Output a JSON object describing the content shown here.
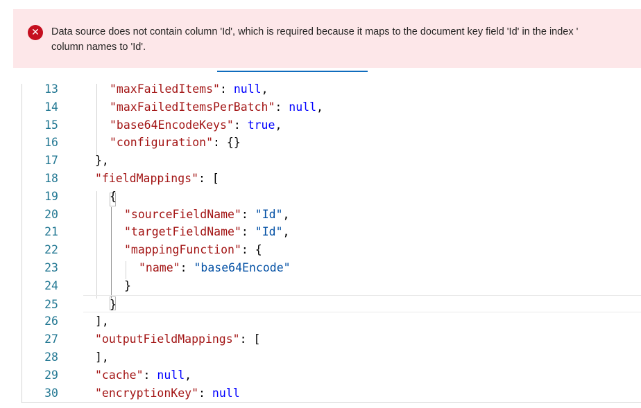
{
  "error": {
    "icon": "error-circle-icon",
    "message_line1": "Data source does not contain column 'Id', which is required because it maps to the document key field 'Id' in the index '",
    "message_line2": "column names to 'Id'."
  },
  "editor": {
    "lines": [
      {
        "num": "13",
        "tokens": [
          {
            "t": "k",
            "v": "\"maxFailedItems\""
          },
          {
            "t": "p",
            "v": ": "
          },
          {
            "t": "b",
            "v": "null"
          },
          {
            "t": "p",
            "v": ","
          }
        ],
        "indent": 2
      },
      {
        "num": "14",
        "tokens": [
          {
            "t": "k",
            "v": "\"maxFailedItemsPerBatch\""
          },
          {
            "t": "p",
            "v": ": "
          },
          {
            "t": "b",
            "v": "null"
          },
          {
            "t": "p",
            "v": ","
          }
        ],
        "indent": 2
      },
      {
        "num": "15",
        "tokens": [
          {
            "t": "k",
            "v": "\"base64EncodeKeys\""
          },
          {
            "t": "p",
            "v": ": "
          },
          {
            "t": "b",
            "v": "true"
          },
          {
            "t": "p",
            "v": ","
          }
        ],
        "indent": 2
      },
      {
        "num": "16",
        "tokens": [
          {
            "t": "k",
            "v": "\"configuration\""
          },
          {
            "t": "p",
            "v": ": {}"
          }
        ],
        "indent": 2
      },
      {
        "num": "17",
        "tokens": [
          {
            "t": "p",
            "v": "},"
          }
        ],
        "indent": 1
      },
      {
        "num": "18",
        "tokens": [
          {
            "t": "k",
            "v": "\"fieldMappings\""
          },
          {
            "t": "p",
            "v": ": ["
          }
        ],
        "indent": 1
      },
      {
        "num": "19",
        "tokens": [
          {
            "t": "p",
            "v": "{"
          }
        ],
        "indent": 2
      },
      {
        "num": "20",
        "tokens": [
          {
            "t": "k",
            "v": "\"sourceFieldName\""
          },
          {
            "t": "p",
            "v": ": "
          },
          {
            "t": "s",
            "v": "\"Id\""
          },
          {
            "t": "p",
            "v": ","
          }
        ],
        "indent": 3
      },
      {
        "num": "21",
        "tokens": [
          {
            "t": "k",
            "v": "\"targetFieldName\""
          },
          {
            "t": "p",
            "v": ": "
          },
          {
            "t": "s",
            "v": "\"Id\""
          },
          {
            "t": "p",
            "v": ","
          }
        ],
        "indent": 3
      },
      {
        "num": "22",
        "tokens": [
          {
            "t": "k",
            "v": "\"mappingFunction\""
          },
          {
            "t": "p",
            "v": ": {"
          }
        ],
        "indent": 3
      },
      {
        "num": "23",
        "tokens": [
          {
            "t": "k",
            "v": "\"name\""
          },
          {
            "t": "p",
            "v": ": "
          },
          {
            "t": "s",
            "v": "\"base64Encode\""
          }
        ],
        "indent": 4
      },
      {
        "num": "24",
        "tokens": [
          {
            "t": "p",
            "v": "}"
          }
        ],
        "indent": 3
      },
      {
        "num": "25",
        "tokens": [
          {
            "t": "p",
            "v": "}"
          }
        ],
        "indent": 2,
        "current": true
      },
      {
        "num": "26",
        "tokens": [
          {
            "t": "p",
            "v": "],"
          }
        ],
        "indent": 1
      },
      {
        "num": "27",
        "tokens": [
          {
            "t": "k",
            "v": "\"outputFieldMappings\""
          },
          {
            "t": "p",
            "v": ": ["
          }
        ],
        "indent": 1
      },
      {
        "num": "28",
        "tokens": [
          {
            "t": "p",
            "v": "],"
          }
        ],
        "indent": 1
      },
      {
        "num": "29",
        "tokens": [
          {
            "t": "k",
            "v": "\"cache\""
          },
          {
            "t": "p",
            "v": ": "
          },
          {
            "t": "b",
            "v": "null"
          },
          {
            "t": "p",
            "v": ","
          }
        ],
        "indent": 1
      },
      {
        "num": "30",
        "tokens": [
          {
            "t": "k",
            "v": "\"encryptionKey\""
          },
          {
            "t": "p",
            "v": ": "
          },
          {
            "t": "b",
            "v": "null"
          }
        ],
        "indent": 1
      }
    ]
  },
  "colors": {
    "error_background": "#fde7e9",
    "error_icon": "#c50f1f",
    "json_key": "#a31515",
    "json_string": "#0451a5",
    "json_literal": "#0000ff",
    "line_number": "#237893",
    "tab_active": "#0f6cbd"
  }
}
